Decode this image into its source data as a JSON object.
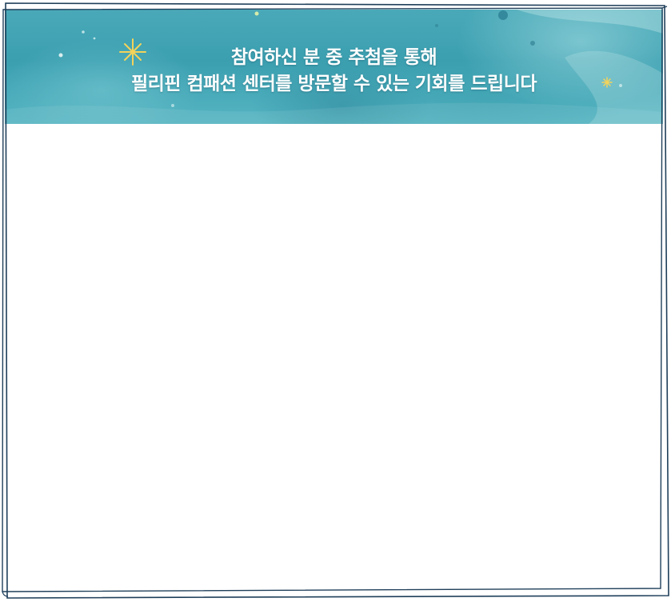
{
  "banner": {
    "line1": "참여하신 분 중 추첨을 통해",
    "line2": "필리핀 컴패션 센터를 방문할 수 있는 기회를 드립니다",
    "background_color": "#46a7b6",
    "text_color": "#ffffff",
    "sparkle_color": "#f3d35a"
  },
  "frame": {
    "border_color": "#1f3f5a"
  }
}
